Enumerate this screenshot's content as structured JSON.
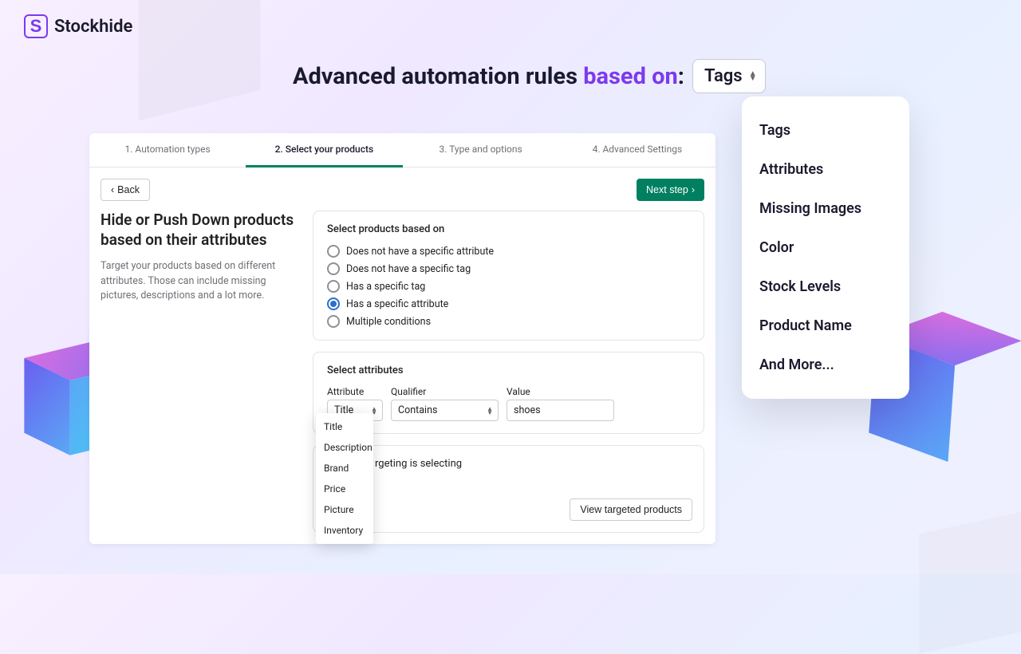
{
  "logo_text": "Stockhide",
  "headline": {
    "prefix": "Advanced automation rules ",
    "accent": "based on",
    "suffix": ":"
  },
  "tag_selected": "Tags",
  "tag_menu": [
    "Tags",
    "Attributes",
    "Missing Images",
    "Color",
    "Stock Levels",
    "Product Name",
    "And More..."
  ],
  "tabs": [
    "1. Automation types",
    "2. Select your products",
    "3. Type and options",
    "4. Advanced Settings"
  ],
  "back_label": "Back",
  "next_label": "Next step",
  "side": {
    "title": "Hide or Push Down products based on their attributes",
    "desc": "Target your products based on different attributes. Those can include missing pictures, descriptions and a lot more."
  },
  "card1": {
    "title": "Select products based on",
    "options": [
      "Does not have a specific attribute",
      "Does not have a specific tag",
      "Has a specific tag",
      "Has a specific attribute",
      "Multiple conditions"
    ],
    "selected_index": 3
  },
  "card2": {
    "title": "Select attributes",
    "labels": {
      "attr": "Attribute",
      "qual": "Qualifier",
      "val": "Value"
    },
    "values": {
      "attr": "Title",
      "qual": "Contains",
      "val": "shoes"
    }
  },
  "attr_menu": [
    "Title",
    "Description",
    "Brand",
    "Price",
    "Picture",
    "Inventory"
  ],
  "target": {
    "text_fragment": "rgeting is selecting",
    "view_btn": "View targeted products"
  }
}
